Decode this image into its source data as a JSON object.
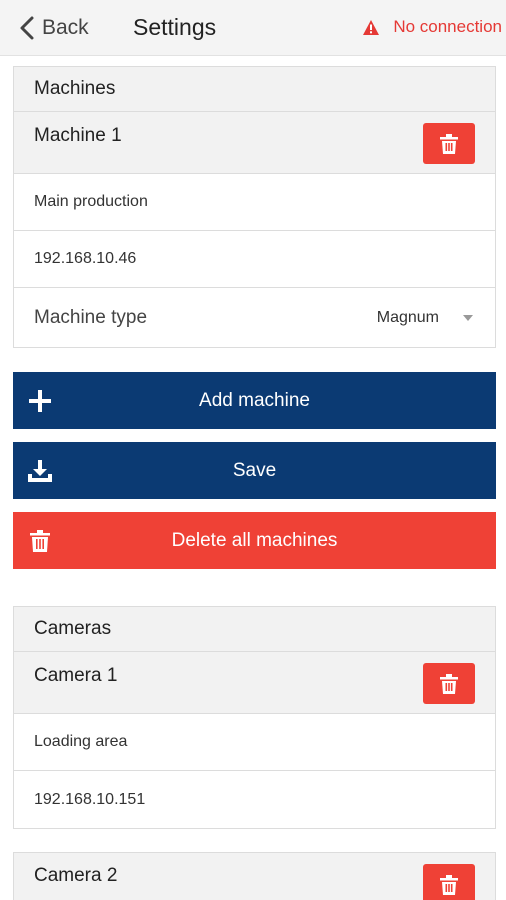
{
  "header": {
    "back_label": "Back",
    "title": "Settings",
    "status_text": "No connection",
    "status_color": "#e53935"
  },
  "machines": {
    "section_title": "Machines",
    "items": [
      {
        "title": "Machine 1",
        "description": "Main production",
        "ip": "192.168.10.46",
        "type_label": "Machine type",
        "type_value": "Magnum"
      }
    ]
  },
  "actions": {
    "add_label": "Add machine",
    "save_label": "Save",
    "delete_all_label": "Delete all machines"
  },
  "cameras": {
    "section_title": "Cameras",
    "items": [
      {
        "title": "Camera 1",
        "description": "Loading area",
        "ip": "192.168.10.151"
      },
      {
        "title": "Camera 2"
      }
    ]
  },
  "colors": {
    "navy": "#0b3a73",
    "red": "#ef4136"
  },
  "icons": [
    "chevron-left-icon",
    "warning-icon",
    "trash-icon",
    "plus-icon",
    "download-icon",
    "chevron-down-icon"
  ]
}
